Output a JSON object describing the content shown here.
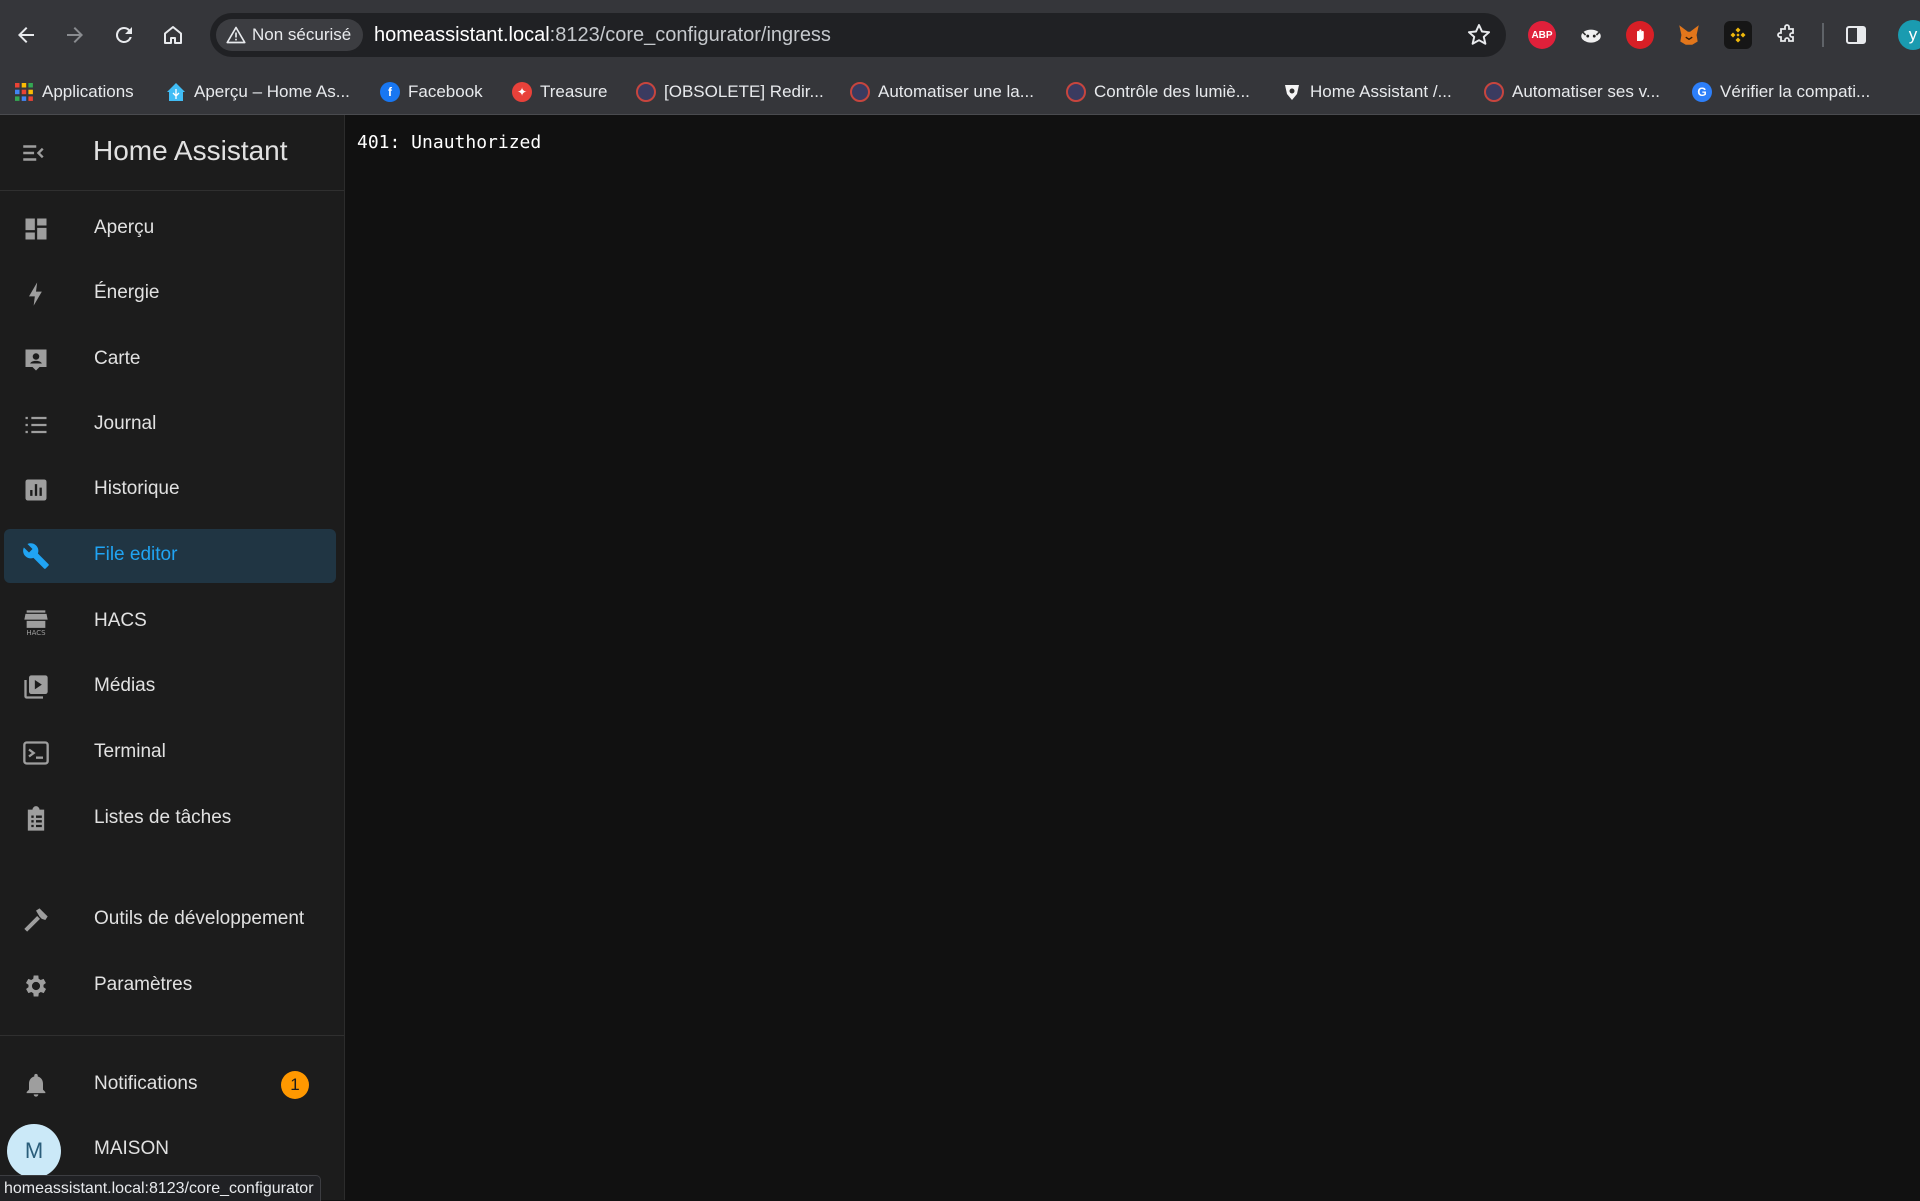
{
  "browser": {
    "security_label": "Non sécurisé",
    "url_host": "homeassistant.local",
    "url_path": ":8123/core_configurator/ingress",
    "status_url": "homeassistant.local:8123/core_configurator",
    "profile_initial": "y",
    "extensions": [
      {
        "name": "adblock-plus-icon",
        "label": "ABP",
        "color": "#e0203a"
      },
      {
        "name": "cat-extension-icon",
        "label": "",
        "color": "#f0f0f0"
      },
      {
        "name": "stop-hand-icon",
        "label": "",
        "color": "#d81f26"
      },
      {
        "name": "metamask-fox-icon",
        "label": "",
        "color": "#e2761b"
      },
      {
        "name": "binance-wallet-icon",
        "label": "",
        "color": "#f0b90b"
      }
    ]
  },
  "bookmarks": [
    {
      "label": "Applications"
    },
    {
      "label": "Aperçu – Home As..."
    },
    {
      "label": "Facebook"
    },
    {
      "label": "Treasure"
    },
    {
      "label": "[OBSOLETE] Redir..."
    },
    {
      "label": "Automatiser une la..."
    },
    {
      "label": "Contrôle des lumiè..."
    },
    {
      "label": "Home Assistant /..."
    },
    {
      "label": "Automatiser ses v..."
    },
    {
      "label": "Vérifier la compati..."
    }
  ],
  "sidebar": {
    "title": "Home Assistant",
    "items": [
      {
        "label": "Aperçu"
      },
      {
        "label": "Énergie"
      },
      {
        "label": "Carte"
      },
      {
        "label": "Journal"
      },
      {
        "label": "Historique"
      },
      {
        "label": "File editor"
      },
      {
        "label": "HACS"
      },
      {
        "label": "Médias"
      },
      {
        "label": "Terminal"
      },
      {
        "label": "Listes de tâches"
      }
    ],
    "tools": [
      {
        "label": "Outils de développement"
      },
      {
        "label": "Paramètres"
      }
    ],
    "notifications": {
      "label": "Notifications",
      "count": "1"
    },
    "user": {
      "initial": "M",
      "name": "MAISON"
    },
    "accent_color": "#20a4f3"
  },
  "main": {
    "message": "401: Unauthorized"
  }
}
